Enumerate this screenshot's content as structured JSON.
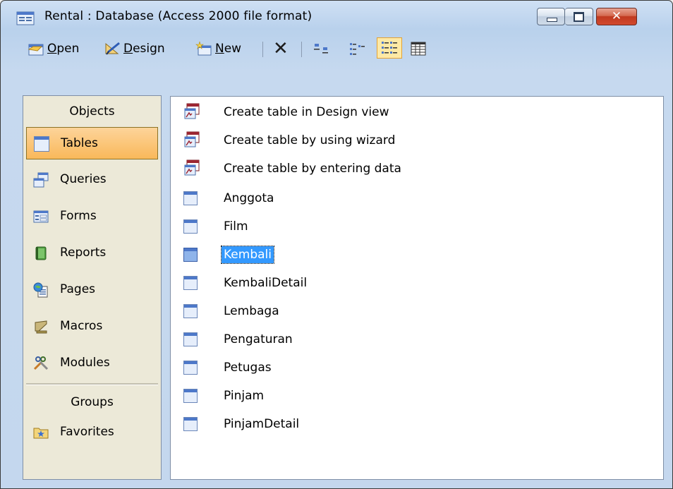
{
  "window": {
    "title": "Rental : Database (Access 2000 file format)",
    "controls": {
      "close_glyph": "✕"
    }
  },
  "toolbar": {
    "open": {
      "mnemonic": "O",
      "rest": "pen"
    },
    "design": {
      "mnemonic": "D",
      "rest": "esign"
    },
    "new": {
      "mnemonic": "N",
      "rest": "ew"
    },
    "delete_glyph": "✕",
    "icons": [
      "open-icon",
      "design-icon",
      "new-icon",
      "delete-icon",
      "large-icons-view-icon",
      "small-icons-view-icon",
      "list-view-icon",
      "details-view-icon"
    ]
  },
  "sidebar": {
    "objects_header": "Objects",
    "items": [
      {
        "label": "Tables",
        "icon": "table-icon",
        "selected": true
      },
      {
        "label": "Queries",
        "icon": "query-icon"
      },
      {
        "label": "Forms",
        "icon": "form-icon"
      },
      {
        "label": "Reports",
        "icon": "report-icon"
      },
      {
        "label": "Pages",
        "icon": "page-icon"
      },
      {
        "label": "Macros",
        "icon": "macro-icon"
      },
      {
        "label": "Modules",
        "icon": "module-icon"
      }
    ],
    "groups_header": "Groups",
    "groups": [
      {
        "label": "Favorites",
        "icon": "favorites-folder-icon"
      }
    ]
  },
  "list": {
    "items": [
      {
        "label": "Create table in Design view",
        "icon": "shortcut-icon"
      },
      {
        "label": "Create table by using wizard",
        "icon": "shortcut-icon"
      },
      {
        "label": "Create table by entering data",
        "icon": "shortcut-icon"
      },
      {
        "label": "Anggota",
        "icon": "table-icon"
      },
      {
        "label": "Film",
        "icon": "table-icon"
      },
      {
        "label": "Kembali",
        "icon": "table-icon",
        "selected": true
      },
      {
        "label": "KembaliDetail",
        "icon": "table-icon"
      },
      {
        "label": "Lembaga",
        "icon": "table-icon"
      },
      {
        "label": "Pengaturan",
        "icon": "table-icon"
      },
      {
        "label": "Petugas",
        "icon": "table-icon"
      },
      {
        "label": "Pinjam",
        "icon": "table-icon"
      },
      {
        "label": "PinjamDetail",
        "icon": "table-icon"
      }
    ]
  },
  "colors": {
    "selection": "#3399ff",
    "sidebar_selected": "#f9b85a",
    "sidebar_bg": "#ece9d8",
    "frame": "#c4d7ee"
  }
}
